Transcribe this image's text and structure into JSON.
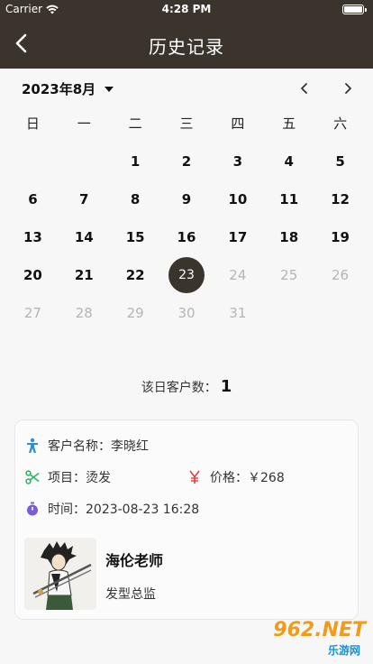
{
  "status_bar": {
    "carrier": "Carrier",
    "time": "4:28 PM"
  },
  "nav": {
    "title": "历史记录"
  },
  "calendar": {
    "month_label": "2023年8月",
    "weekdays": [
      "日",
      "一",
      "二",
      "三",
      "四",
      "五",
      "六"
    ],
    "selected_day": "23",
    "weeks": [
      [
        {
          "d": "",
          "m": false
        },
        {
          "d": "",
          "m": false
        },
        {
          "d": "1",
          "m": false
        },
        {
          "d": "2",
          "m": false
        },
        {
          "d": "3",
          "m": false
        },
        {
          "d": "4",
          "m": false
        },
        {
          "d": "5",
          "m": false
        }
      ],
      [
        {
          "d": "6",
          "m": false
        },
        {
          "d": "7",
          "m": false
        },
        {
          "d": "8",
          "m": false
        },
        {
          "d": "9",
          "m": false
        },
        {
          "d": "10",
          "m": false
        },
        {
          "d": "11",
          "m": false
        },
        {
          "d": "12",
          "m": false
        }
      ],
      [
        {
          "d": "13",
          "m": false
        },
        {
          "d": "14",
          "m": false
        },
        {
          "d": "15",
          "m": false
        },
        {
          "d": "16",
          "m": false
        },
        {
          "d": "17",
          "m": false
        },
        {
          "d": "18",
          "m": false
        },
        {
          "d": "19",
          "m": false
        }
      ],
      [
        {
          "d": "20",
          "m": false
        },
        {
          "d": "21",
          "m": false
        },
        {
          "d": "22",
          "m": false
        },
        {
          "d": "23",
          "m": false
        },
        {
          "d": "24",
          "m": true
        },
        {
          "d": "25",
          "m": true
        },
        {
          "d": "26",
          "m": true
        }
      ],
      [
        {
          "d": "27",
          "m": true
        },
        {
          "d": "28",
          "m": true
        },
        {
          "d": "29",
          "m": true
        },
        {
          "d": "30",
          "m": true
        },
        {
          "d": "31",
          "m": true
        },
        {
          "d": "",
          "m": true
        },
        {
          "d": "",
          "m": true
        }
      ]
    ]
  },
  "summary": {
    "label": "该日客户数：",
    "count": "1"
  },
  "record": {
    "customer": "客户名称：李晓红",
    "item": "项目：烫发",
    "price": "价格：￥268",
    "time": "时间：2023-08-23 16:28",
    "stylist_name": "海伦老师",
    "stylist_role": "发型总监"
  },
  "icons": {
    "customer": "person-icon",
    "item": "scissors-icon",
    "price": "yuan-icon",
    "time": "stopwatch-icon"
  },
  "colors": {
    "header": "#3a342d",
    "person_icon": "#2d8fd5",
    "scissors_icon": "#2bb56b",
    "yuan_icon": "#e0403a",
    "stopwatch_icon": "#7c5cd6"
  },
  "watermark": {
    "big": "962.NET",
    "small": "乐游网"
  }
}
